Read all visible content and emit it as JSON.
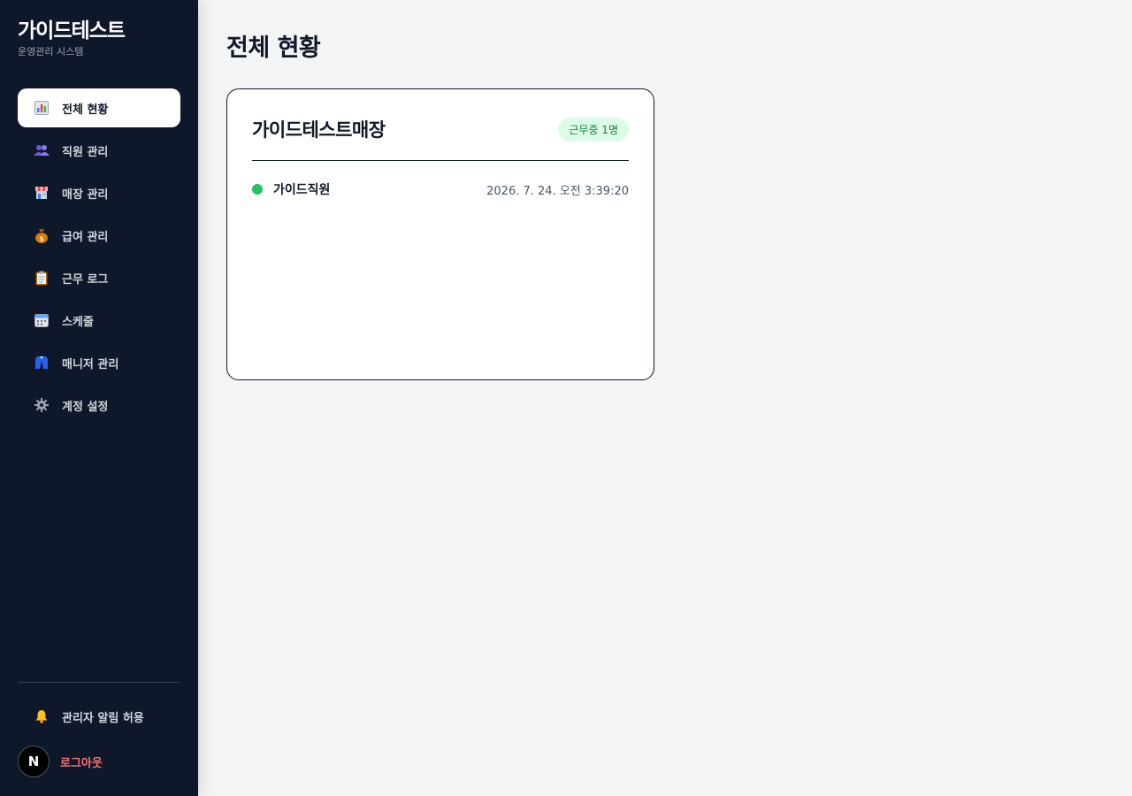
{
  "sidebar": {
    "brand_title": "가이드테스트",
    "brand_subtitle": "운영관리 시스템",
    "items": [
      {
        "label": "전체 현황",
        "icon": "bar-chart-icon",
        "active": true
      },
      {
        "label": "직원 관리",
        "icon": "users-icon"
      },
      {
        "label": "매장 관리",
        "icon": "store-icon"
      },
      {
        "label": "급여 관리",
        "icon": "money-bag-icon"
      },
      {
        "label": "근무 로그",
        "icon": "clipboard-icon"
      },
      {
        "label": "스케줄",
        "icon": "calendar-icon"
      },
      {
        "label": "매니저 관리",
        "icon": "suit-icon"
      },
      {
        "label": "계정 설정",
        "icon": "gear-icon"
      }
    ],
    "notify_label": "관리자 알림 허용",
    "notify_icon": "bell-icon",
    "avatar_letter": "N",
    "logout_label": "로그아웃"
  },
  "main": {
    "page_title": "전체 현황",
    "store": {
      "name": "가이드테스트매장",
      "badge": "근무중 1명",
      "staff": [
        {
          "name": "가이드직원",
          "time": "2026. 7. 24. 오전 3:39:20",
          "status_color": "#22c55e"
        }
      ]
    }
  },
  "colors": {
    "sidebar_bg": "#0f172a",
    "page_bg": "#f3f4f6",
    "logout": "#f87171",
    "badge_bg": "#dcfce7",
    "badge_text": "#15803d"
  }
}
